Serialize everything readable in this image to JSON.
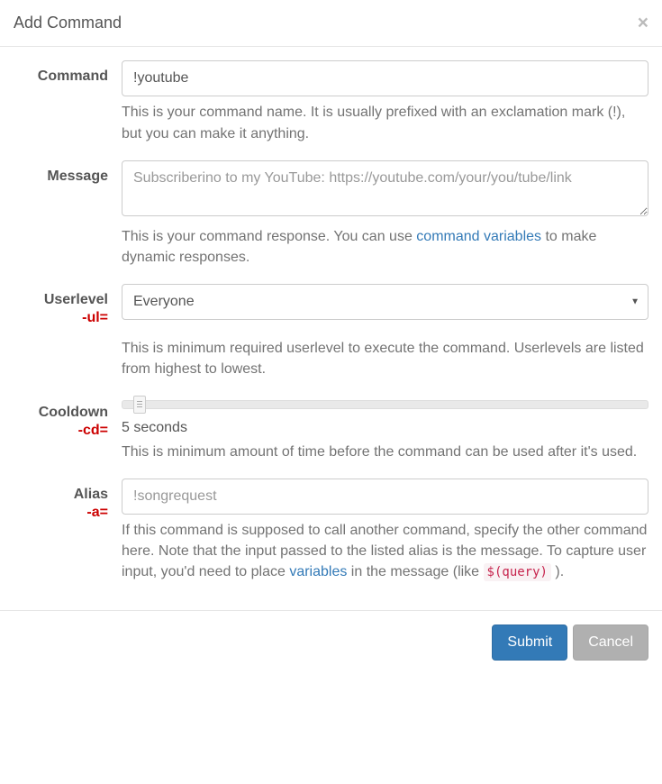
{
  "header": {
    "title": "Add Command"
  },
  "fields": {
    "command": {
      "label": "Command",
      "value": "!youtube",
      "help": "This is your command name. It is usually prefixed with an exclamation mark (!), but you can make it anything."
    },
    "message": {
      "label": "Message",
      "placeholder": "Subscriberino to my YouTube: https://youtube.com/your/you/tube/link",
      "help_before": "This is your command response. You can use ",
      "help_link": "command variables",
      "help_after": " to make dynamic responses."
    },
    "userlevel": {
      "label": "Userlevel",
      "annotation": "-ul=",
      "selected": "Everyone",
      "help": "This is minimum required userlevel to execute the command. Userlevels are listed from highest to lowest."
    },
    "cooldown": {
      "label": "Cooldown",
      "annotation": "-cd=",
      "value_text": "5 seconds",
      "help": "This is minimum amount of time before the command can be used after it's used."
    },
    "alias": {
      "label": "Alias",
      "annotation": "-a=",
      "placeholder": "!songrequest",
      "help_before": "If this command is supposed to call another command, specify the other command here. Note that the input passed to the listed alias is the message. To capture user input, you'd need to place ",
      "help_link": "variables",
      "help_mid": " in the message (like ",
      "help_code": "$(query)",
      "help_after": " )."
    }
  },
  "footer": {
    "submit": "Submit",
    "cancel": "Cancel"
  }
}
